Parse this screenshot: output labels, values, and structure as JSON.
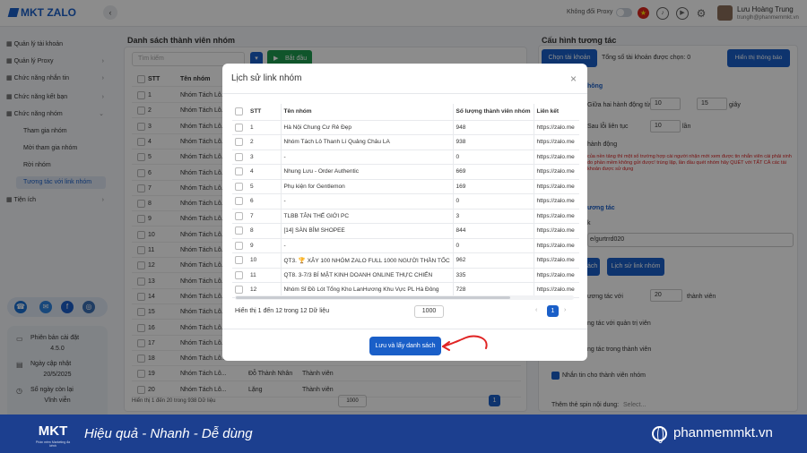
{
  "app": {
    "logo_text": "MKT ZALO"
  },
  "topbar": {
    "proxy_label": "Không đổi Proxy",
    "user_name": "Lưu Hoàng Trung",
    "user_email": "trunglh@phanmemmkt.vn"
  },
  "sidebar": {
    "items": [
      {
        "label": "Quản lý tài khoản"
      },
      {
        "label": "Quản lý Proxy"
      },
      {
        "label": "Chức năng nhắn tin"
      },
      {
        "label": "Chức năng kết bạn"
      },
      {
        "label": "Chức năng nhóm"
      }
    ],
    "subitems": [
      {
        "label": "Tham gia nhóm"
      },
      {
        "label": "Mời tham gia nhóm"
      },
      {
        "label": "Rời nhóm"
      },
      {
        "label": "Tương tác với link nhóm"
      }
    ],
    "utility": "Tiện ích"
  },
  "info": {
    "version_label": "Phiên bản cài đặt",
    "version_value": "4.5.0",
    "update_label": "Ngày cập nhật",
    "update_value": "20/5/2025",
    "days_label": "Số ngày còn lại",
    "days_value": "Vĩnh viễn"
  },
  "main": {
    "title": "Danh sách thành viên nhóm",
    "search_placeholder": "Tìm kiếm",
    "start_label": "Bắt đầu",
    "col_stt": "STT",
    "col_name": "Tên nhóm",
    "rows": [
      {
        "stt": "1",
        "name": "Nhóm Tách Lô..."
      },
      {
        "stt": "2",
        "name": "Nhóm Tách Lô..."
      },
      {
        "stt": "3",
        "name": "Nhóm Tách Lô..."
      },
      {
        "stt": "4",
        "name": "Nhóm Tách Lô..."
      },
      {
        "stt": "5",
        "name": "Nhóm Tách Lô..."
      },
      {
        "stt": "6",
        "name": "Nhóm Tách Lô..."
      },
      {
        "stt": "7",
        "name": "Nhóm Tách Lô..."
      },
      {
        "stt": "8",
        "name": "Nhóm Tách Lô..."
      },
      {
        "stt": "9",
        "name": "Nhóm Tách Lô..."
      },
      {
        "stt": "10",
        "name": "Nhóm Tách Lô..."
      },
      {
        "stt": "11",
        "name": "Nhóm Tách Lô..."
      },
      {
        "stt": "12",
        "name": "Nhóm Tách Lô..."
      },
      {
        "stt": "13",
        "name": "Nhóm Tách Lô..."
      },
      {
        "stt": "14",
        "name": "Nhóm Tách Lô..."
      },
      {
        "stt": "15",
        "name": "Nhóm Tách Lô..."
      },
      {
        "stt": "16",
        "name": "Nhóm Tách Lô..."
      },
      {
        "stt": "17",
        "name": "Nhóm Tách Lô..."
      },
      {
        "stt": "18",
        "name": "Nhóm Tách Lô..."
      },
      {
        "stt": "19",
        "name": "Nhóm Tách Lô...",
        "member": "Đỗ Thành Nhân",
        "role": "Thành viên"
      },
      {
        "stt": "20",
        "name": "Nhóm Tách Lô...",
        "member": "Lặng",
        "role": "Thành viên"
      }
    ],
    "summary": "Hiển thị 1 đến 20 trong 938 Dữ liệu",
    "page_size": "1000",
    "page": "1"
  },
  "right": {
    "title": "Cấu hình tương tác",
    "choose_account": "Chọn tài khoản",
    "selected_count": "Tổng số tài khoản được chọn: 0",
    "show_info": "Hiển thị thông báo",
    "section_label": "hông",
    "delay_label": "Giữa hai hành động từ",
    "delay_from": "10",
    "delay_to": "15",
    "delay_unit": "giây",
    "error_label": "Sau lỗi liên tục",
    "error_value": "10",
    "error_unit": "lần",
    "stop_label": "hành động",
    "warning": "của nền tảng thì một số trường hợp cài người nhận mới xem được tin nhắn viên cài phải xinh do phần mềm không gửi được! trùng lặp, lần đầu quét nhóm hãy QUÉT với TẤT CẢ các tài khoản được sử dụng",
    "tab_label": "ương tác",
    "link_label": "k",
    "link_value": "e/gurtrrd020",
    "btn_left": "ách",
    "history_btn": "Lịch sử link nhóm",
    "interact_label": "ương tác với",
    "interact_count": "20",
    "interact_unit": "thành viên",
    "opt1": "ng tác với quản trị viên",
    "opt2": "ng tác trong thành viên",
    "opt3": "Nhắn tin cho thành viên nhóm",
    "spin_label": "Thêm thẻ spin nội dung:",
    "spin_placeholder": "Select..."
  },
  "modal": {
    "title": "Lịch sử link nhóm",
    "col_stt": "STT",
    "col_name": "Tên nhóm",
    "col_count": "Số lượng thành viên nhóm",
    "col_link": "Liên kết",
    "rows": [
      {
        "stt": "1",
        "name": "Hà Nội Chung Cư Rẻ Đẹp",
        "count": "948",
        "link": "https://zalo.me"
      },
      {
        "stt": "2",
        "name": "Nhóm Tách Lô Thanh Lí Quảng Châu LA",
        "count": "938",
        "link": "https://zalo.me"
      },
      {
        "stt": "3",
        "name": "-",
        "count": "0",
        "link": "https://zalo.me"
      },
      {
        "stt": "4",
        "name": "Nhung Lưu - Order Authentic",
        "count": "669",
        "link": "https://zalo.me"
      },
      {
        "stt": "5",
        "name": "Phụ kiện for Gentlemon",
        "count": "169",
        "link": "https://zalo.me"
      },
      {
        "stt": "6",
        "name": "-",
        "count": "0",
        "link": "https://zalo.me"
      },
      {
        "stt": "7",
        "name": "TLBB TÂN THẾ GIỚI PC",
        "count": "3",
        "link": "https://zalo.me"
      },
      {
        "stt": "8",
        "name": "[14] SÀN BỈM SHOPEE",
        "count": "844",
        "link": "https://zalo.me"
      },
      {
        "stt": "9",
        "name": "-",
        "count": "0",
        "link": "https://zalo.me"
      },
      {
        "stt": "10",
        "name": "QT3. 🏆 XÂY 100 NHÓM ZALO FULL 1000 NGƯỜI THẦN TỐC",
        "count": "962",
        "link": "https://zalo.me"
      },
      {
        "stt": "11",
        "name": "QT8. 3-7/3 BÍ MẬT KINH DOANH ONLINE THỰC CHIẾN",
        "count": "335",
        "link": "https://zalo.me"
      },
      {
        "stt": "12",
        "name": "Nhóm Sỉ Đồ Lót Tổng Kho LanHương Khu Vực PL Hà Đông",
        "count": "728",
        "link": "https://zalo.me"
      }
    ],
    "summary": "Hiển thị 1 đến 12 trong 12 Dữ liệu",
    "page_size": "1000",
    "page": "1",
    "save_label": "Lưu và lấy danh sách"
  },
  "footer": {
    "logo": "MKT",
    "logo_sub": "Phần mềm Marketing đa kênh",
    "slogan": "Hiệu quả - Nhanh - Dễ dùng",
    "site": "phanmemmkt.vn"
  },
  "colors": {
    "primary": "#1a5fc8",
    "footer": "#1c3f8f",
    "success": "#1e9b4f",
    "warning": "#d92020"
  }
}
